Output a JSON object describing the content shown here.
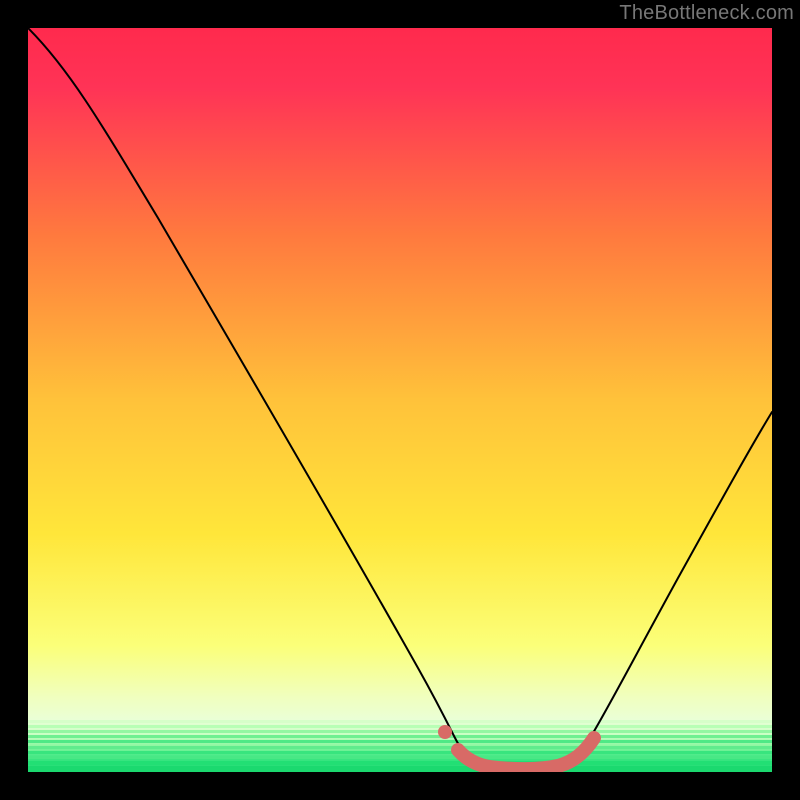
{
  "watermark": "TheBottleneck.com",
  "colors": {
    "gradient_top": "#ff2e55",
    "gradient_mid": "#ffe63a",
    "gradient_band": "#f6ffd3",
    "gradient_green": "#2de37c",
    "curve": "#000000",
    "accent": "#d86a66",
    "background": "#000000"
  },
  "chart_data": {
    "type": "line",
    "title": "",
    "xlabel": "",
    "ylabel": "",
    "x_range": [
      0,
      1
    ],
    "y_range": [
      0,
      1
    ],
    "curve_points": [
      [
        0.0,
        1.0
      ],
      [
        0.05,
        0.97
      ],
      [
        0.1,
        0.9
      ],
      [
        0.3,
        0.55
      ],
      [
        0.48,
        0.2
      ],
      [
        0.54,
        0.07
      ],
      [
        0.56,
        0.04
      ],
      [
        0.58,
        0.02
      ],
      [
        0.6,
        0.01
      ],
      [
        0.63,
        0.005
      ],
      [
        0.67,
        0.005
      ],
      [
        0.71,
        0.01
      ],
      [
        0.74,
        0.02
      ],
      [
        0.76,
        0.04
      ],
      [
        0.8,
        0.1
      ],
      [
        0.88,
        0.25
      ],
      [
        0.95,
        0.38
      ],
      [
        1.0,
        0.48
      ]
    ],
    "annotations": {
      "highlighted_segment_x": [
        0.57,
        0.76
      ],
      "marker_x": 0.555
    }
  }
}
